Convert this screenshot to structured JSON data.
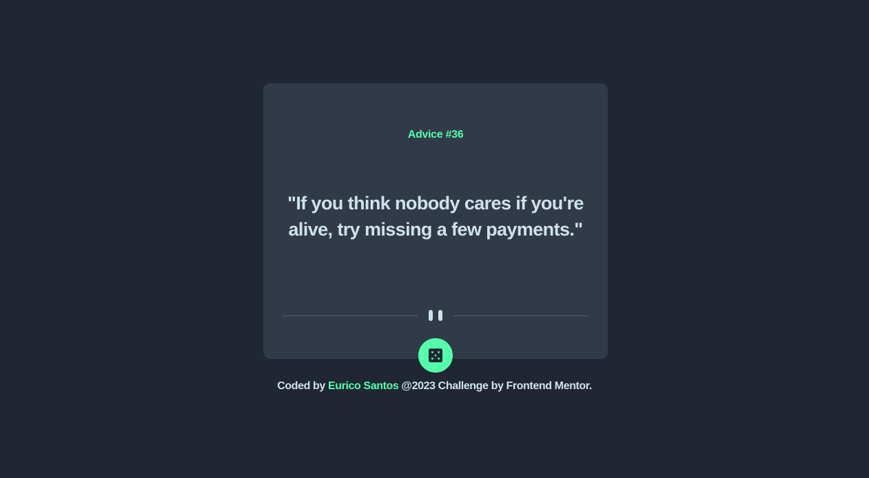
{
  "card": {
    "advice_id": "Advice #36",
    "advice_text": "\"If you think nobody cares if you're alive, try missing a few payments.\""
  },
  "dice_button": {
    "icon": "dice-icon"
  },
  "divider": {
    "icon": "pause-icon"
  },
  "footer": {
    "prefix": "Coded by",
    "author": "Eurico Santos",
    "suffix": "@2023 Challenge by Frontend Mentor."
  },
  "colors": {
    "background": "#202632",
    "card": "#313a48",
    "accent": "#53ffaa",
    "text": "#cee3e9",
    "divider": "#4f5d74"
  }
}
